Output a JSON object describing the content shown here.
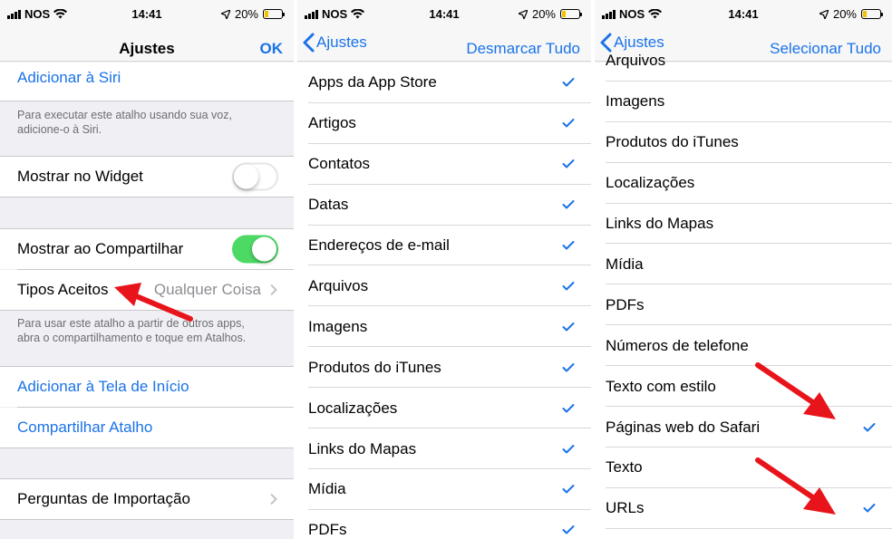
{
  "status": {
    "carrier": "NOS",
    "time": "14:41",
    "battery": "20%"
  },
  "colors": {
    "accent": "#1a73e8",
    "toggle_on": "#4cd964",
    "arrow": "#e8141b",
    "battery_fill": "#f5c000"
  },
  "screen1": {
    "nav_title": "Ajustes",
    "nav_done": "OK",
    "add_siri": "Adicionar à Siri",
    "siri_note_1": "Para executar este atalho usando sua voz,",
    "siri_note_2": "adicione-o à Siri.",
    "show_widget": "Mostrar no Widget",
    "show_widget_on": false,
    "show_share": "Mostrar ao Compartilhar",
    "show_share_on": true,
    "accepted_types": "Tipos Aceitos",
    "accepted_types_value": "Qualquer Coisa",
    "share_note_1": "Para usar este atalho a partir de outros apps,",
    "share_note_2": "abra o compartilhamento e toque em Atalhos.",
    "add_home": "Adicionar à Tela de Início",
    "share_shortcut": "Compartilhar Atalho",
    "import_questions": "Perguntas de Importação"
  },
  "screen2": {
    "back": "Ajustes",
    "action": "Desmarcar Tudo",
    "items": [
      {
        "label": "Apps da App Store",
        "checked": true
      },
      {
        "label": "Artigos",
        "checked": true
      },
      {
        "label": "Contatos",
        "checked": true
      },
      {
        "label": "Datas",
        "checked": true
      },
      {
        "label": "Endereços de e-mail",
        "checked": true
      },
      {
        "label": "Arquivos",
        "checked": true
      },
      {
        "label": "Imagens",
        "checked": true
      },
      {
        "label": "Produtos do iTunes",
        "checked": true
      },
      {
        "label": "Localizações",
        "checked": true
      },
      {
        "label": "Links do Mapas",
        "checked": true
      },
      {
        "label": "Mídia",
        "checked": true
      },
      {
        "label": "PDFs",
        "checked": true
      }
    ]
  },
  "screen3": {
    "back": "Ajustes",
    "action": "Selecionar Tudo",
    "items": [
      {
        "label": "Arquivos",
        "checked": false
      },
      {
        "label": "Imagens",
        "checked": false
      },
      {
        "label": "Produtos do iTunes",
        "checked": false
      },
      {
        "label": "Localizações",
        "checked": false
      },
      {
        "label": "Links do Mapas",
        "checked": false
      },
      {
        "label": "Mídia",
        "checked": false
      },
      {
        "label": "PDFs",
        "checked": false
      },
      {
        "label": "Números de telefone",
        "checked": false
      },
      {
        "label": "Texto com estilo",
        "checked": false
      },
      {
        "label": "Páginas web do Safari",
        "checked": true
      },
      {
        "label": "Texto",
        "checked": false
      },
      {
        "label": "URLs",
        "checked": true
      }
    ]
  }
}
